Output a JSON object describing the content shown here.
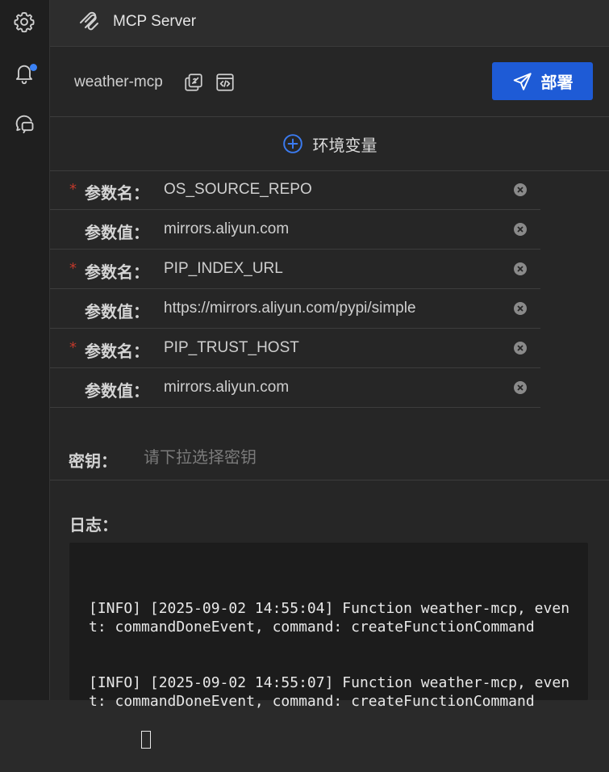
{
  "topbar": {
    "title": "MCP Server"
  },
  "server": {
    "name": "weather-mcp"
  },
  "deploy_label": "部署",
  "env": {
    "label": "环境变量"
  },
  "params": [
    {
      "label": "参数名：",
      "value": "OS_SOURCE_REPO",
      "required": true
    },
    {
      "label": "参数值：",
      "value": "mirrors.aliyun.com",
      "required": false
    },
    {
      "label": "参数名：",
      "value": "PIP_INDEX_URL",
      "required": true
    },
    {
      "label": "参数值：",
      "value": "https://mirrors.aliyun.com/pypi/simple",
      "required": false
    },
    {
      "label": "参数名：",
      "value": "PIP_TRUST_HOST",
      "required": true
    },
    {
      "label": "参数值：",
      "value": "mirrors.aliyun.com",
      "required": false
    }
  ],
  "secret": {
    "label": "密钥：",
    "placeholder": "请下拉选择密钥"
  },
  "log": {
    "label": "日志：",
    "lines": [
      "[INFO] [2025-09-02 14:55:04] Function weather-mcp, event: commandDoneEvent, command: createFunctionCommand",
      "[INFO] [2025-09-02 14:55:07] Function weather-mcp, event: commandDoneEvent, command: createFunctionCommand"
    ]
  },
  "colors": {
    "accent": "#1e5bd6",
    "required_star": "#c0392b",
    "notification_dot": "#3b82f6"
  },
  "icons": [
    "gear-icon",
    "bell-icon",
    "chat-icon",
    "mcp-logo-icon",
    "copy-icon",
    "code-icon",
    "send-icon",
    "plus-circle-icon",
    "clear-icon"
  ]
}
